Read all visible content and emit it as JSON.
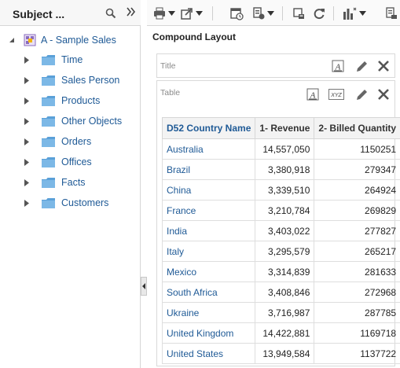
{
  "subject_panel": {
    "title": "Subject ...",
    "root": {
      "label": "A - Sample Sales"
    },
    "folders": [
      {
        "label": "Time"
      },
      {
        "label": "Sales Person"
      },
      {
        "label": "Products"
      },
      {
        "label": "Other Objects"
      },
      {
        "label": "Orders"
      },
      {
        "label": "Offices"
      },
      {
        "label": "Facts"
      },
      {
        "label": "Customers"
      }
    ]
  },
  "toolbar": {
    "icons": [
      "print-icon",
      "export-icon",
      "schedule-icon",
      "refresh-data-icon",
      "report-options-icon",
      "refresh-icon",
      "view-properties-icon",
      "more-icon"
    ]
  },
  "layout": {
    "title": "Compound Layout",
    "title_view": {
      "caption": "Title"
    },
    "table_view": {
      "caption": "Table"
    }
  },
  "table": {
    "columns": [
      "D52 Country Name",
      "1- Revenue",
      "2- Billed Quantity"
    ],
    "rows": [
      {
        "country": "Australia",
        "revenue": "14,557,050",
        "quantity": "1150251"
      },
      {
        "country": "Brazil",
        "revenue": "3,380,918",
        "quantity": "279347"
      },
      {
        "country": "China",
        "revenue": "3,339,510",
        "quantity": "264924"
      },
      {
        "country": "France",
        "revenue": "3,210,784",
        "quantity": "269829"
      },
      {
        "country": "India",
        "revenue": "3,403,022",
        "quantity": "277827"
      },
      {
        "country": "Italy",
        "revenue": "3,295,579",
        "quantity": "265217"
      },
      {
        "country": "Mexico",
        "revenue": "3,314,839",
        "quantity": "281633"
      },
      {
        "country": "South Africa",
        "revenue": "3,408,846",
        "quantity": "272968"
      },
      {
        "country": "Ukraine",
        "revenue": "3,716,987",
        "quantity": "287785"
      },
      {
        "country": "United Kingdom",
        "revenue": "14,422,881",
        "quantity": "1169718"
      },
      {
        "country": "United States",
        "revenue": "13,949,584",
        "quantity": "1137722"
      }
    ]
  },
  "colors": {
    "link": "#1f5a96",
    "folder": "#5aa0d8",
    "header_bg": "#f3f3f3"
  }
}
